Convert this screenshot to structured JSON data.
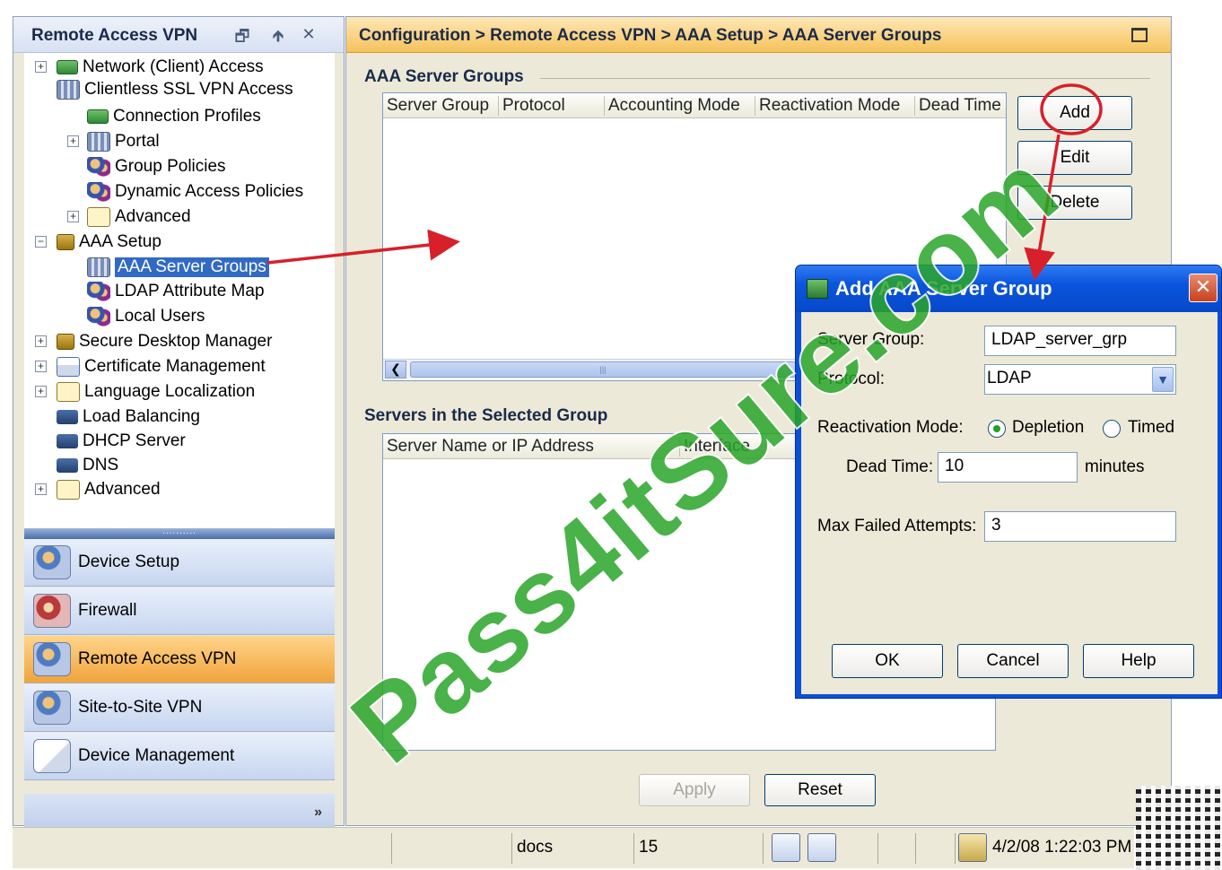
{
  "left_panel": {
    "title": "Remote Access VPN",
    "controls": [
      "🗗",
      "🡹",
      "✕"
    ],
    "tree": [
      {
        "label": "Network (Client) Access",
        "expander": "+",
        "icon": "network-client-icon"
      },
      {
        "label": "Clientless SSL VPN Access",
        "expander": "−",
        "icon": "clientless-vpn-icon"
      },
      {
        "label": "Connection Profiles",
        "expander": "",
        "icon": "connection-profiles-icon"
      },
      {
        "label": "Portal",
        "expander": "+",
        "icon": "portal-icon"
      },
      {
        "label": "Group Policies",
        "expander": "",
        "icon": "group-policies-icon"
      },
      {
        "label": "Dynamic Access Policies",
        "expander": "",
        "icon": "dynamic-access-icon"
      },
      {
        "label": "Advanced",
        "expander": "+",
        "icon": "advanced-icon"
      },
      {
        "label": "AAA Setup",
        "expander": "−",
        "icon": "lock-icon"
      },
      {
        "label": "AAA Server Groups",
        "expander": "",
        "icon": "server-groups-icon",
        "selected": true
      },
      {
        "label": "LDAP Attribute Map",
        "expander": "",
        "icon": "ldap-map-icon"
      },
      {
        "label": "Local Users",
        "expander": "",
        "icon": "local-users-icon"
      },
      {
        "label": "Secure Desktop Manager",
        "expander": "+",
        "icon": "secure-desktop-icon"
      },
      {
        "label": "Certificate Management",
        "expander": "+",
        "icon": "certificate-icon"
      },
      {
        "label": "Language Localization",
        "expander": "+",
        "icon": "language-icon"
      },
      {
        "label": "Load Balancing",
        "expander": "",
        "icon": "load-balancing-icon"
      },
      {
        "label": "DHCP Server",
        "expander": "",
        "icon": "dhcp-icon"
      },
      {
        "label": "DNS",
        "expander": "",
        "icon": "dns-icon"
      },
      {
        "label": "Advanced",
        "expander": "+",
        "icon": "advanced-icon"
      }
    ],
    "splitter_grip": "..........",
    "sections": [
      {
        "label": "Device Setup",
        "active": false
      },
      {
        "label": "Firewall",
        "active": false
      },
      {
        "label": "Remote Access VPN",
        "active": true
      },
      {
        "label": "Site-to-Site VPN",
        "active": false
      },
      {
        "label": "Device Management",
        "active": false
      }
    ],
    "footer_chevron": "»"
  },
  "right_panel": {
    "breadcrumb": "Configuration > Remote Access VPN > AAA Setup > AAA Server Groups",
    "server_groups": {
      "title": "AAA Server Groups",
      "columns": [
        "Server Group",
        "Protocol",
        "Accounting Mode",
        "Reactivation Mode",
        "Dead Time"
      ],
      "buttons": {
        "add": "Add",
        "edit": "Edit",
        "delete": "Delete"
      }
    },
    "servers": {
      "title": "Servers in the Selected Group",
      "columns": [
        "Server Name or IP Address",
        "Interface"
      ]
    },
    "apply_label": "Apply",
    "reset_label": "Reset"
  },
  "dialog": {
    "title": "Add AAA Server Group",
    "close_label": "✕",
    "server_group_label": "Server Group:",
    "server_group_value": "LDAP_server_grp",
    "protocol_label": "Protocol:",
    "protocol_value": "LDAP",
    "reactivation_label": "Reactivation Mode:",
    "reactivation_options": [
      "Depletion",
      "Timed"
    ],
    "reactivation_selected": "Depletion",
    "dead_time_label": "Dead Time:",
    "dead_time_value": "10",
    "dead_time_unit": "minutes",
    "max_failed_label": "Max Failed Attempts:",
    "max_failed_value": "3",
    "ok_label": "OK",
    "cancel_label": "Cancel",
    "help_label": "Help"
  },
  "status_bar": {
    "user": "docs",
    "privilege": "15",
    "timestamp": "4/2/08 1:22:03 PM"
  },
  "watermark": "Pass4itSure.com",
  "colors": {
    "selection": "#316ac5",
    "active_section": "#f0a43c",
    "dialog_title": "#0a55dd",
    "annotation_red": "#d8202a",
    "watermark_green": "#2aa52a"
  }
}
